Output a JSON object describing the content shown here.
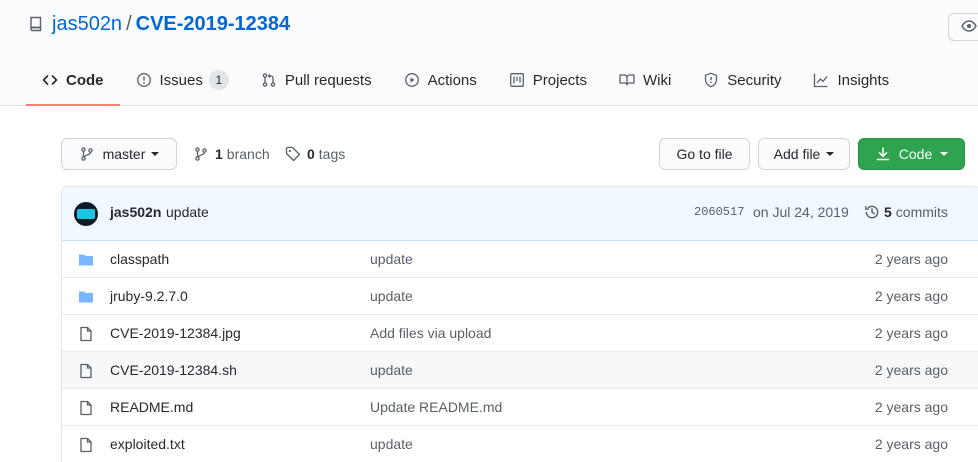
{
  "repo": {
    "owner": "jas502n",
    "separator": "/",
    "name": "CVE-2019-12384"
  },
  "nav": {
    "tabs": [
      {
        "label": "Code",
        "icon": "code-icon",
        "selected": true
      },
      {
        "label": "Issues",
        "icon": "issue-icon",
        "count": "1"
      },
      {
        "label": "Pull requests",
        "icon": "pull-request-icon"
      },
      {
        "label": "Actions",
        "icon": "play-icon"
      },
      {
        "label": "Projects",
        "icon": "project-icon"
      },
      {
        "label": "Wiki",
        "icon": "book-icon"
      },
      {
        "label": "Security",
        "icon": "shield-icon"
      },
      {
        "label": "Insights",
        "icon": "graph-icon"
      }
    ]
  },
  "toolbar": {
    "branch": "master",
    "branch_count": "1",
    "branch_label": "branch",
    "tag_count": "0",
    "tag_label": "tags",
    "go_to_file": "Go to file",
    "add_file": "Add file",
    "code": "Code"
  },
  "commit": {
    "author": "jas502n",
    "message": "update",
    "sha": "2060517",
    "date": "on Jul 24, 2019",
    "count": "5",
    "count_label": "commits"
  },
  "files": [
    {
      "name": "classpath",
      "type": "folder",
      "message": "update",
      "age": "2 years ago"
    },
    {
      "name": "jruby-9.2.7.0",
      "type": "folder",
      "message": "update",
      "age": "2 years ago"
    },
    {
      "name": "CVE-2019-12384.jpg",
      "type": "file",
      "message": "Add files via upload",
      "age": "2 years ago"
    },
    {
      "name": "CVE-2019-12384.sh",
      "type": "file",
      "message": "update",
      "age": "2 years ago"
    },
    {
      "name": "README.md",
      "type": "file",
      "message": "Update README.md",
      "age": "2 years ago"
    },
    {
      "name": "exploited.txt",
      "type": "file",
      "message": "update",
      "age": "2 years ago"
    }
  ],
  "colors": {
    "link": "#0366d6",
    "primary_button": "#2ea44f",
    "selected_tab_underline": "#f9826c",
    "folder_icon": "#79b8ff"
  }
}
